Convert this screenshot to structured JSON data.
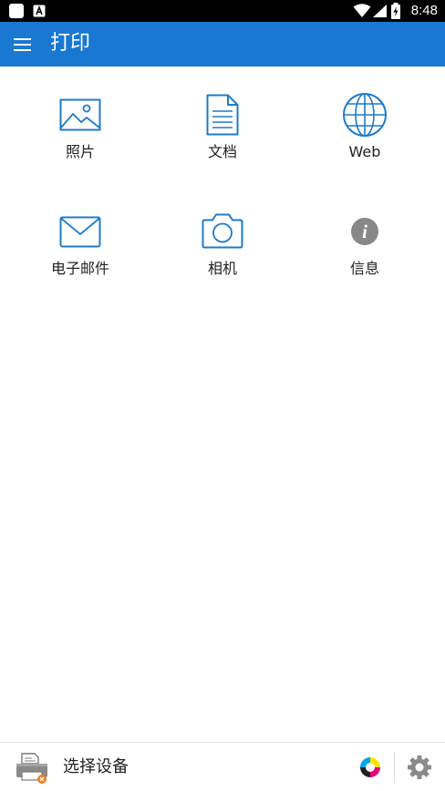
{
  "status_bar": {
    "time": "8:48",
    "left_icons": [
      "app-notification-icon",
      "font-a-icon"
    ],
    "right_icons": [
      "wifi-icon",
      "cell-signal-icon",
      "battery-charging-icon"
    ]
  },
  "app_bar": {
    "title": "打印",
    "menu_icon": "hamburger-menu-icon"
  },
  "tiles": [
    {
      "label": "照片",
      "icon": "photo-icon"
    },
    {
      "label": "文档",
      "icon": "document-icon"
    },
    {
      "label": "Web",
      "icon": "globe-icon"
    },
    {
      "label": "电子邮件",
      "icon": "email-icon"
    },
    {
      "label": "相机",
      "icon": "camera-icon"
    },
    {
      "label": "信息",
      "icon": "info-icon"
    }
  ],
  "bottom_bar": {
    "device_label": "选择设备",
    "printer_icon": "printer-disconnected-icon",
    "ink_icon": "ink-color-icon",
    "settings_icon": "gear-icon"
  },
  "colors": {
    "primary": "#1978d2",
    "icon_blue": "#1f7bc8",
    "info_gray": "#888888",
    "error_orange": "#f07d1c"
  }
}
